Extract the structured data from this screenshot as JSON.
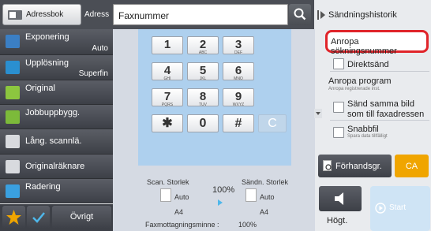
{
  "header": {
    "address_book_label": "Adressbok",
    "address_label": "Adress",
    "fax_number_placeholder": "Faxnummer"
  },
  "left_menu": [
    {
      "label": "Exponering",
      "value": "Auto"
    },
    {
      "label": "Upplösning",
      "value": "Superfin"
    },
    {
      "label": "Original",
      "value": ""
    },
    {
      "label": "Jobbuppbygg.",
      "value": ""
    },
    {
      "label": "Lång. scannlä.",
      "value": ""
    },
    {
      "label": "Originalräknare",
      "value": ""
    },
    {
      "label": "Radering",
      "value": ""
    }
  ],
  "bottom_bar": {
    "other_label": "Övrigt"
  },
  "keypad": [
    {
      "digit": "1",
      "letters": ""
    },
    {
      "digit": "2",
      "letters": "ABC"
    },
    {
      "digit": "3",
      "letters": "DEF"
    },
    {
      "digit": "4",
      "letters": "GHI"
    },
    {
      "digit": "5",
      "letters": "JKL"
    },
    {
      "digit": "6",
      "letters": "MNO"
    },
    {
      "digit": "7",
      "letters": "PQRS"
    },
    {
      "digit": "8",
      "letters": "TUV"
    },
    {
      "digit": "9",
      "letters": "WXYZ"
    },
    {
      "digit": "✱",
      "letters": ""
    },
    {
      "digit": "0",
      "letters": ""
    },
    {
      "digit": "#",
      "letters": ""
    }
  ],
  "clear_label": "C",
  "scan_info": {
    "scan_size_label": "Scan. Storlek",
    "send_size_label": "Sändn. Storlek",
    "scan_mode": "Auto",
    "send_mode": "Auto",
    "scan_paper": "A4",
    "send_paper": "A4",
    "ratio": "100%",
    "memory_label": "Faxmottagningsminne :",
    "memory_value": "100%"
  },
  "right_panel": {
    "history_label": "Sändningshistorik",
    "polling_address_label": "Anropa sökningsnummer",
    "direct_send_label": "Direktsänd",
    "polling_program_label": "Anropa program",
    "polling_program_sub": "Anropa registrerade inst.",
    "same_image_label_1": "Sänd samma bild",
    "same_image_label_2": "som till faxadressen",
    "quick_file_label": "Snabbfil",
    "quick_file_sub": "Spara data tillfälligt",
    "preview_label": "Förhandsgr.",
    "ca_label": "CA",
    "speaker_label": "Högt.",
    "start_label": "Start"
  },
  "colors": {
    "accent_orange": "#f0a500",
    "highlight_red": "#e0242a",
    "keypad_bg": "#aed0ee"
  }
}
